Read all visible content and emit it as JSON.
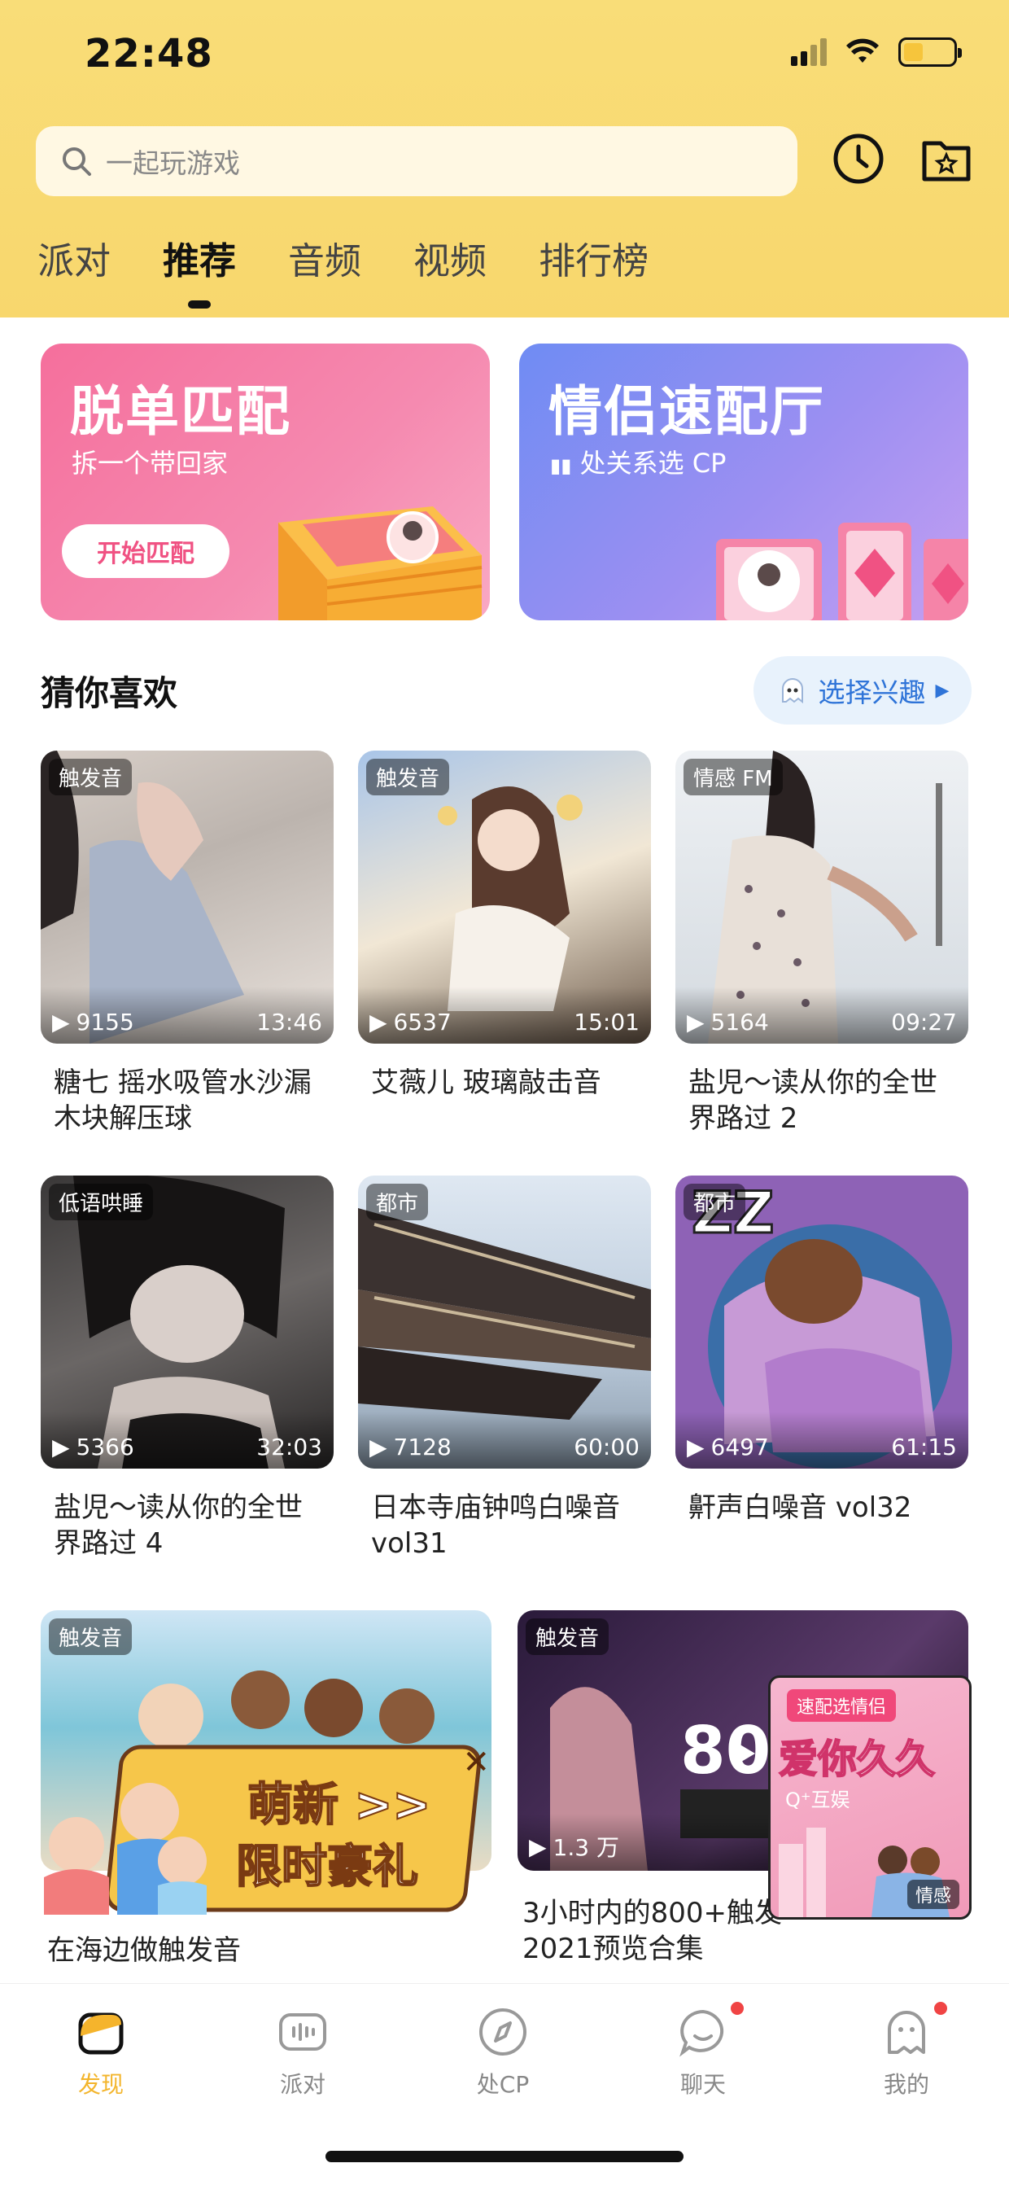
{
  "status": {
    "time": "22:48"
  },
  "search": {
    "placeholder": "一起玩游戏"
  },
  "tabs": [
    "派对",
    "推荐",
    "音频",
    "视频",
    "排行榜"
  ],
  "banners": [
    {
      "title": "脱单匹配",
      "subtitle": "拆一个带回家",
      "button": "开始匹配"
    },
    {
      "title": "情侣速配厅",
      "subtitle": "处关系选 CP"
    }
  ],
  "section": {
    "title": "猜你喜欢",
    "interest_button": "选择兴趣"
  },
  "items": [
    {
      "tag": "触发音",
      "plays": "9155",
      "duration": "13:46",
      "title": "糖七 摇水吸管水沙漏木块解压球"
    },
    {
      "tag": "触发音",
      "plays": "6537",
      "duration": "15:01",
      "title": "艾薇儿 玻璃敲击音"
    },
    {
      "tag": "情感 FM",
      "plays": "5164",
      "duration": "09:27",
      "title": "盐児～读从你的全世界路过 2"
    },
    {
      "tag": "低语哄睡",
      "plays": "5366",
      "duration": "32:03",
      "title": "盐児～读从你的全世界路过 4"
    },
    {
      "tag": "都市",
      "plays": "7128",
      "duration": "60:00",
      "title": "日本寺庙钟鸣白噪音 vol31"
    },
    {
      "tag": "都市",
      "plays": "6497",
      "duration": "61:15",
      "title": "鼾声白噪音 vol32"
    }
  ],
  "wide_items": [
    {
      "tag": "触发音",
      "title": "在海边做触发音"
    },
    {
      "tag": "触发音",
      "plays": "1.3 万",
      "title": "3小时内的800+触发\n2021预览合集"
    }
  ],
  "promo": {
    "line1": "萌新 >>",
    "line2": "限时豪礼"
  },
  "float_card": {
    "badge": "速配选情侣",
    "title": "爱你久久",
    "subtitle": "Q⁺互娱",
    "tag": "情感"
  },
  "bottom_nav": [
    "发现",
    "派对",
    "处CP",
    "聊天",
    "我的"
  ],
  "colors": {
    "header": "#f8d76d",
    "accent": "#f3b52c",
    "pink": "#f56f9c",
    "blue": "#6f8cf3",
    "link": "#2f74d8"
  }
}
